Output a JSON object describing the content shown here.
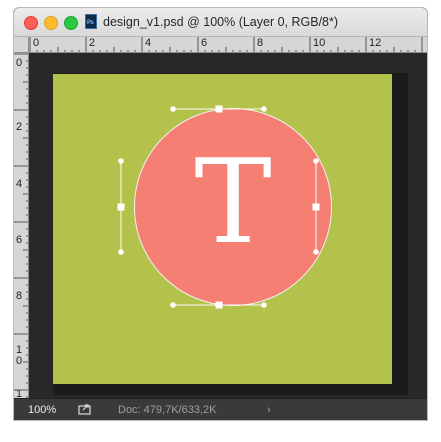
{
  "window": {
    "title": "design_v1.psd @ 100% (Layer 0, RGB/8*)",
    "doc_icon_text": "Ps"
  },
  "rulers": {
    "top_labels": [
      "0",
      "2",
      "4",
      "6",
      "8",
      "10",
      "12"
    ],
    "left_labels": [
      "0",
      "2",
      "4",
      "6",
      "8",
      "1\n0",
      "1"
    ]
  },
  "canvas": {
    "background_color": "#b3c24b",
    "circle_color": "#f47f72",
    "letter": "T"
  },
  "statusbar": {
    "zoom": "100%",
    "doc_info": "Doc: 479,7K/633,2K",
    "arrow": "›",
    "share_icon": "export-icon"
  }
}
